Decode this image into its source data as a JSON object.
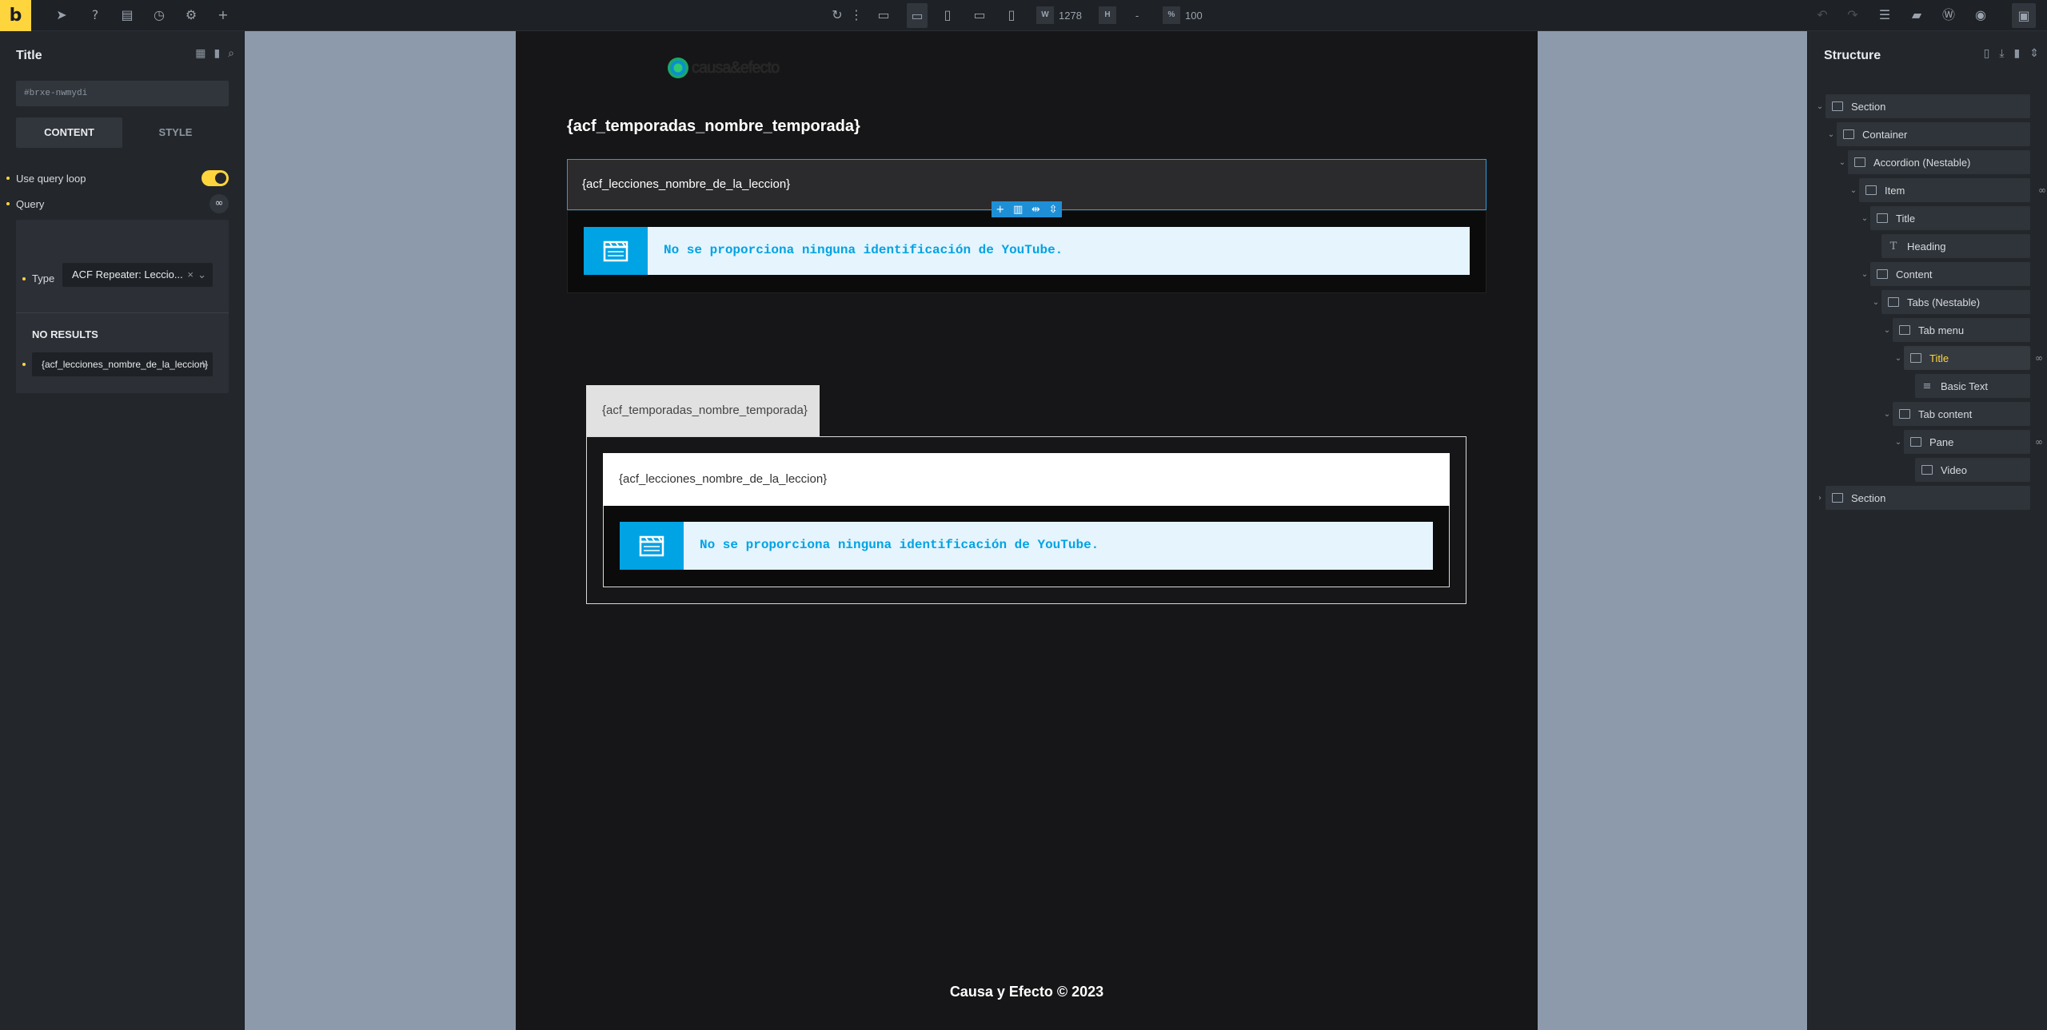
{
  "toolbar": {
    "logo": "b",
    "width_label": "W",
    "width_value": "1278",
    "height_label": "H",
    "height_value": "-",
    "zoom_label": "%",
    "zoom_value": "100"
  },
  "left_panel": {
    "title": "Title",
    "element_id": "#brxe-nwmydi",
    "tabs": [
      "CONTENT",
      "STYLE"
    ],
    "use_query_loop_label": "Use query loop",
    "use_query_loop_on": true,
    "query_label": "Query",
    "type_label": "Type",
    "type_value": "ACF Repeater: Leccio...",
    "no_results": "NO RESULTS",
    "dynamic_value": "{acf_lecciones_nombre_de_la_leccion}"
  },
  "canvas": {
    "logo_text": "causa&efecto",
    "season_title": "{acf_temporadas_nombre_temporada}",
    "accordion_title": "{acf_lecciones_nombre_de_la_leccion}",
    "youtube_message": "No se proporciona ninguna identificación de YouTube.",
    "tab_title": "{acf_temporadas_nombre_temporada}",
    "inner_title": "{acf_lecciones_nombre_de_la_leccion}",
    "youtube_message_2": "No se proporciona ninguna identificación de YouTube.",
    "footer": "Causa y Efecto © 2023"
  },
  "structure": {
    "title": "Structure",
    "nodes": [
      {
        "label": "Section"
      },
      {
        "label": "Container"
      },
      {
        "label": "Accordion (Nestable)"
      },
      {
        "label": "Item"
      },
      {
        "label": "Title"
      },
      {
        "label": "Heading"
      },
      {
        "label": "Content"
      },
      {
        "label": "Tabs (Nestable)"
      },
      {
        "label": "Tab menu"
      },
      {
        "label": "Title"
      },
      {
        "label": "Basic Text"
      },
      {
        "label": "Tab content"
      },
      {
        "label": "Pane"
      },
      {
        "label": "Video"
      },
      {
        "label": "Section"
      }
    ]
  },
  "colors": {
    "accent": "#ffd53e",
    "selection": "#1e8fd6",
    "video_blue": "#00a3e4"
  }
}
